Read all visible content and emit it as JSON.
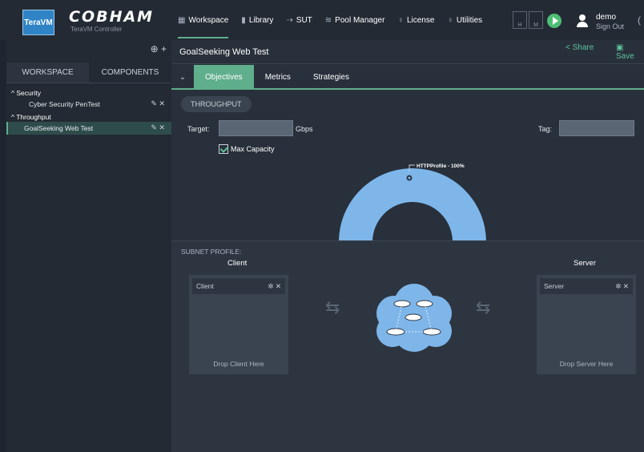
{
  "app": {
    "badge": "TeraVM",
    "brand": "COBHAM",
    "subtitle": "TeraVM Controller"
  },
  "nav": {
    "items": [
      {
        "label": "Workspace",
        "icon": "grid-icon",
        "active": true
      },
      {
        "label": "Library",
        "icon": "book-icon"
      },
      {
        "label": "SUT",
        "icon": "link-icon"
      },
      {
        "label": "Pool Manager",
        "icon": "stack-icon"
      },
      {
        "label": "License",
        "icon": "ribbon-icon"
      },
      {
        "label": "Utilities",
        "icon": "ribbon-icon"
      }
    ],
    "hm": [
      "H",
      "M"
    ]
  },
  "user": {
    "name": "demo",
    "sign_out": "Sign Out"
  },
  "sidebar": {
    "tools": "⊕ +",
    "tabs": [
      "WORKSPACE",
      "COMPONENTS"
    ],
    "groups": [
      {
        "label": "^ Security",
        "items": [
          {
            "label": "Cyber Security PenTest"
          }
        ]
      },
      {
        "label": "^ Throughput",
        "items": [
          {
            "label": "GoalSeeking Web Test",
            "selected": true
          }
        ]
      }
    ]
  },
  "main": {
    "title": "GoalSeeking Web Test",
    "share": "Share",
    "save": "Save",
    "tabs": [
      "Objectives",
      "Metrics",
      "Strategies"
    ],
    "pill": "THROUGHPUT",
    "target_label": "Target:",
    "unit": "Gbps",
    "tag_label": "Tag:",
    "max_capacity": "Max Capacity",
    "chart_label": "HTTPProfile - 100%",
    "subnet_label": "SUBNET PROFILE:",
    "client_title": "Client",
    "server_title": "Server",
    "client_box": "Client",
    "server_box": "Server",
    "client_drop": "Drop Client Here",
    "server_drop": "Drop Server Here"
  },
  "colors": {
    "accent": "#5fae8c",
    "donut": "#7eb6ea",
    "play": "#4dbd74"
  }
}
